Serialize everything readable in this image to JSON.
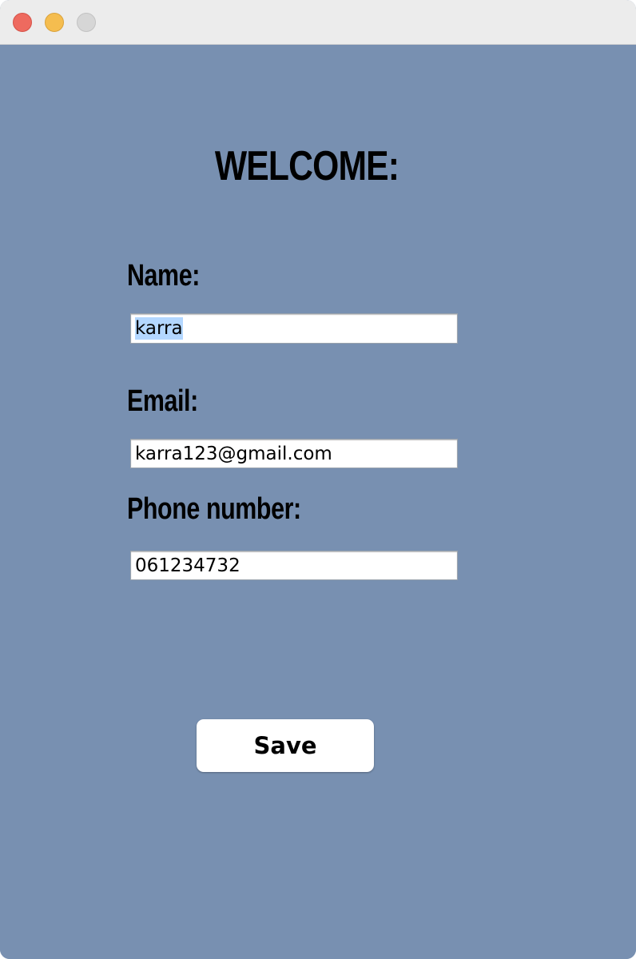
{
  "window": {
    "background_color": "#7890b1",
    "titlebar_buttons": [
      "close",
      "minimize",
      "zoom"
    ]
  },
  "form": {
    "heading": "WELCOME:",
    "name": {
      "label": "Name:",
      "value": "karra",
      "selected": true
    },
    "email": {
      "label": "Email:",
      "value": "karra123@gmail.com"
    },
    "phone": {
      "label": "Phone number:",
      "value": "061234732"
    },
    "save_label": "Save"
  }
}
